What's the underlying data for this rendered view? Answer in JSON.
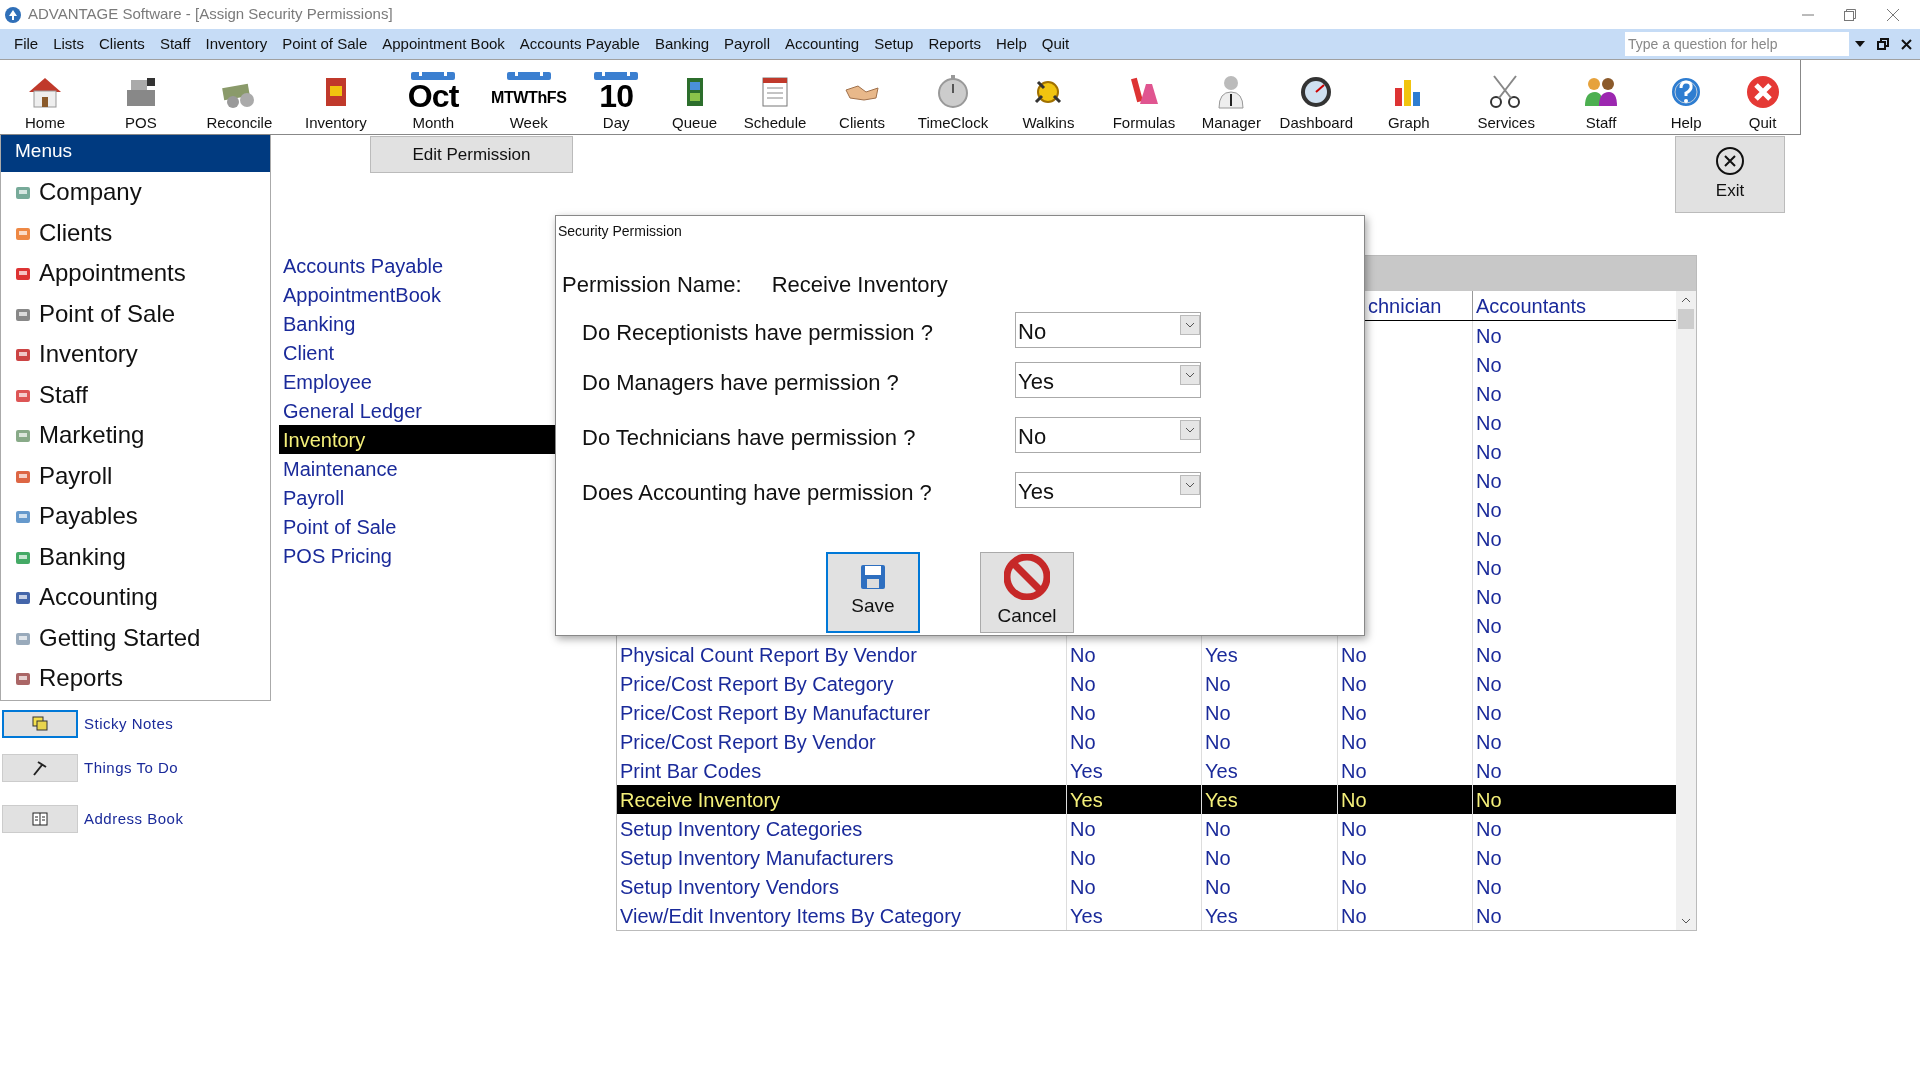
{
  "window": {
    "title": "ADVANTAGE Software - [Assign Security Permissions]"
  },
  "menu_bar": [
    "File",
    "Lists",
    "Clients",
    "Staff",
    "Inventory",
    "Point of Sale",
    "Appointment Book",
    "Accounts Payable",
    "Banking",
    "Payroll",
    "Accounting",
    "Setup",
    "Reports",
    "Help",
    "Quit"
  ],
  "help_search": {
    "placeholder": "Type a question for help"
  },
  "toolbar": [
    {
      "label": "Home"
    },
    {
      "label": "POS"
    },
    {
      "label": "Reconcile"
    },
    {
      "label": "Inventory"
    },
    {
      "label": "Month",
      "icon_text": "Oct"
    },
    {
      "label": "Week",
      "icon_text": "MTWThFS"
    },
    {
      "label": "Day",
      "icon_text": "10"
    },
    {
      "label": "Queue"
    },
    {
      "label": "Schedule"
    },
    {
      "label": "Clients"
    },
    {
      "label": "TimeClock"
    },
    {
      "label": "Walkins"
    },
    {
      "label": "Formulas"
    },
    {
      "label": "Manager"
    },
    {
      "label": "Dashboard"
    },
    {
      "label": "Graph"
    },
    {
      "label": "Services"
    },
    {
      "label": "Staff"
    },
    {
      "label": "Help"
    },
    {
      "label": "Quit"
    }
  ],
  "sidebar": {
    "title": "Menus",
    "items": [
      "Company",
      "Clients",
      "Appointments",
      "Point of Sale",
      "Inventory",
      "Staff",
      "Marketing",
      "Payroll",
      "Payables",
      "Banking",
      "Accounting",
      "Getting Started",
      "Reports"
    ]
  },
  "shortcuts": [
    {
      "label": "Sticky Notes",
      "selected": true
    },
    {
      "label": "Things To Do",
      "selected": false
    },
    {
      "label": "Address Book",
      "selected": false
    }
  ],
  "edit_button": "Edit Permission",
  "exit_button": "Exit",
  "categories": [
    {
      "label": "Accounts Payable",
      "selected": false
    },
    {
      "label": "AppointmentBook",
      "selected": false
    },
    {
      "label": "Banking",
      "selected": false
    },
    {
      "label": "Client",
      "selected": false
    },
    {
      "label": "Employee",
      "selected": false
    },
    {
      "label": "General Ledger",
      "selected": false
    },
    {
      "label": "Inventory",
      "selected": true
    },
    {
      "label": "Maintenance",
      "selected": false
    },
    {
      "label": "Payroll",
      "selected": false
    },
    {
      "label": "Point of Sale",
      "selected": false
    },
    {
      "label": "POS Pricing",
      "selected": false
    }
  ],
  "table": {
    "columns": {
      "column_4": "chnician",
      "column_5": "Accountants"
    },
    "rows": [
      {
        "column_5": "No",
        "selected": false
      },
      {
        "column_5": "No",
        "selected": false
      },
      {
        "column_5": "No",
        "selected": false
      },
      {
        "column_5": "No",
        "selected": false
      },
      {
        "column_5": "No",
        "selected": false
      },
      {
        "column_5": "No",
        "selected": false
      },
      {
        "column_5": "No",
        "selected": false
      },
      {
        "column_5": "No",
        "selected": false
      },
      {
        "column_5": "No",
        "selected": false
      },
      {
        "column_5": "No",
        "selected": false
      },
      {
        "column_5": "No",
        "selected": false
      },
      {
        "column_1": "Physical Count Report By Vendor",
        "column_2": "No",
        "column_3": "Yes",
        "column_4": "No",
        "column_5": "No",
        "selected": false
      },
      {
        "column_1": "Price/Cost Report By Category",
        "column_2": "No",
        "column_3": "No",
        "column_4": "No",
        "column_5": "No",
        "selected": false
      },
      {
        "column_1": "Price/Cost Report By Manufacturer",
        "column_2": "No",
        "column_3": "No",
        "column_4": "No",
        "column_5": "No",
        "selected": false
      },
      {
        "column_1": "Price/Cost Report By Vendor",
        "column_2": "No",
        "column_3": "No",
        "column_4": "No",
        "column_5": "No",
        "selected": false
      },
      {
        "column_1": "Print Bar Codes",
        "column_2": "Yes",
        "column_3": "Yes",
        "column_4": "No",
        "column_5": "No",
        "selected": false
      },
      {
        "column_1": "Receive Inventory",
        "column_2": "Yes",
        "column_3": "Yes",
        "column_4": "No",
        "column_5": "No",
        "selected": true
      },
      {
        "column_1": "Setup Inventory Categories",
        "column_2": "No",
        "column_3": "No",
        "column_4": "No",
        "column_5": "No",
        "selected": false
      },
      {
        "column_1": "Setup Inventory Manufacturers",
        "column_2": "No",
        "column_3": "No",
        "column_4": "No",
        "column_5": "No",
        "selected": false
      },
      {
        "column_1": "Setup Inventory Vendors",
        "column_2": "No",
        "column_3": "No",
        "column_4": "No",
        "column_5": "No",
        "selected": false
      },
      {
        "column_1": "View/Edit Inventory Items By Category",
        "column_2": "Yes",
        "column_3": "Yes",
        "column_4": "No",
        "column_5": "No",
        "selected": false
      }
    ]
  },
  "dialog": {
    "title": "Security Permission",
    "name_label": "Permission Name:",
    "name_value": "Receive Inventory",
    "questions": [
      {
        "label": "Do Receptionists have permission ?",
        "value": "No"
      },
      {
        "label": "Do Managers have permission ?",
        "value": "Yes"
      },
      {
        "label": "Do Technicians have permission ?",
        "value": "No"
      },
      {
        "label": "Does Accounting have permission ?",
        "value": "Yes"
      }
    ],
    "buttons": [
      {
        "label": "Save",
        "kind": "save"
      },
      {
        "label": "Cancel",
        "kind": "cancel"
      }
    ]
  }
}
